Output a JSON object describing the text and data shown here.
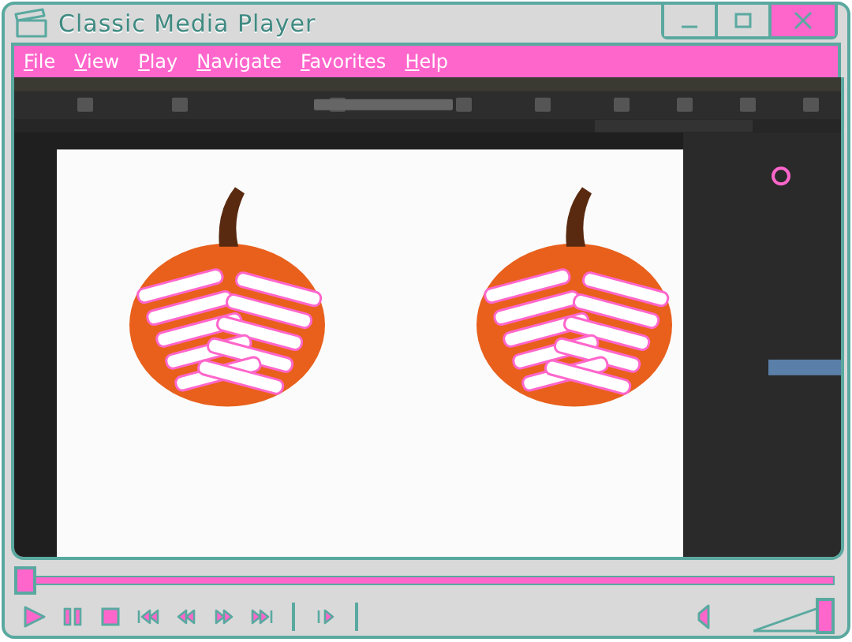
{
  "window": {
    "title": "Classic Media Player"
  },
  "menu": [
    {
      "key": "F",
      "rest": "ile"
    },
    {
      "key": "V",
      "rest": "iew"
    },
    {
      "key": "P",
      "rest": "lay"
    },
    {
      "key": "N",
      "rest": "avigate"
    },
    {
      "key": "F",
      "rest": "avorites"
    },
    {
      "key": "H",
      "rest": "elp"
    }
  ],
  "seek": {
    "level": 0
  },
  "controls": [
    {
      "kind": "play"
    },
    {
      "kind": "pause"
    },
    {
      "kind": "stop"
    },
    {
      "kind": "skip-back"
    },
    {
      "kind": "rewind"
    },
    {
      "kind": "fast-forward"
    },
    {
      "kind": "skip-forward"
    },
    {
      "kind": "separator"
    },
    {
      "kind": "frame-step"
    },
    {
      "kind": "separator"
    }
  ],
  "volume": {
    "level": 1
  }
}
